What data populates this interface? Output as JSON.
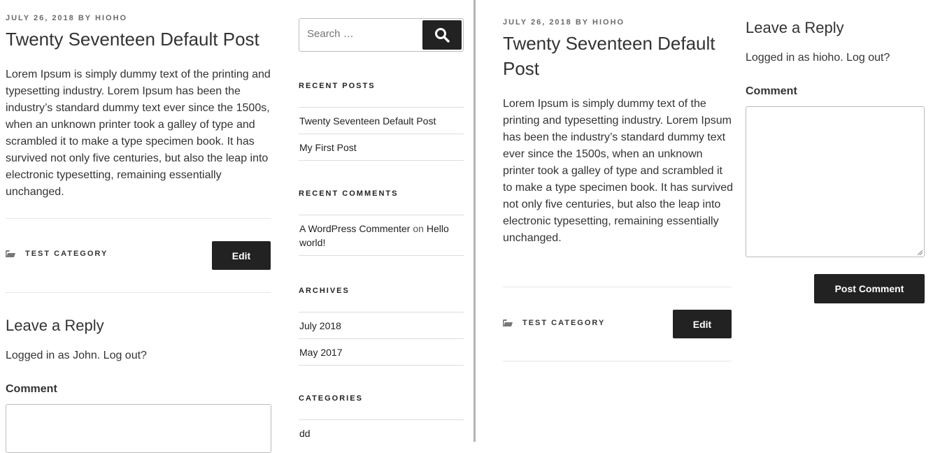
{
  "post": {
    "date": "JULY 26, 2018",
    "by": "BY",
    "author": "HIOHO",
    "title": "Twenty Seventeen Default Post",
    "body": "Lorem Ipsum is simply dummy text of the printing and typesetting industry. Lorem Ipsum has been the industry’s standard dummy text ever since the 1500s, when an unknown printer took a galley of type and scrambled it to make a type specimen book. It has survived not only five centuries, but also the leap into electronic typesetting, remaining essentially unchanged.",
    "category": "TEST CATEGORY",
    "edit_label": "Edit"
  },
  "left_reply": {
    "title": "Leave a Reply",
    "logged_in": "Logged in as John. Log out?",
    "comment_label": "Comment"
  },
  "right_reply": {
    "title": "Leave a Reply",
    "logged_in": "Logged in as hioho. Log out?",
    "comment_label": "Comment",
    "submit_label": "Post Comment"
  },
  "sidebar": {
    "search_placeholder": "Search …",
    "recent_posts": {
      "title": "RECENT POSTS",
      "items": [
        "Twenty Seventeen Default Post",
        "My First Post"
      ]
    },
    "recent_comments": {
      "title": "RECENT COMMENTS",
      "author": "A WordPress Commenter",
      "on": "on",
      "post": "Hello world!"
    },
    "archives": {
      "title": "ARCHIVES",
      "items": [
        "July 2018",
        "May 2017"
      ]
    },
    "categories": {
      "title": "CATEGORIES",
      "items": [
        "dd"
      ]
    }
  },
  "colors": {
    "button_bg": "#222222",
    "divider": "#b4b4b4",
    "rule": "#e6e6e6"
  }
}
